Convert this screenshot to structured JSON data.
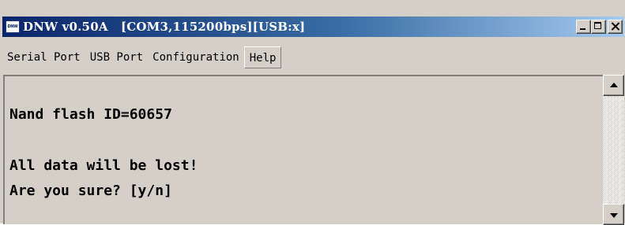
{
  "window": {
    "icon_label": "DNW",
    "title": "DNW v0.50A   [COM3,115200bps][USB:x]"
  },
  "menu": {
    "items": [
      {
        "label": "Serial Port"
      },
      {
        "label": "USB Port"
      },
      {
        "label": "Configuration"
      },
      {
        "label": "Help"
      }
    ]
  },
  "terminal": {
    "lines": [
      "Nand flash ID=60657",
      "All data will be lost!",
      "Are you sure? [y/n]"
    ]
  }
}
